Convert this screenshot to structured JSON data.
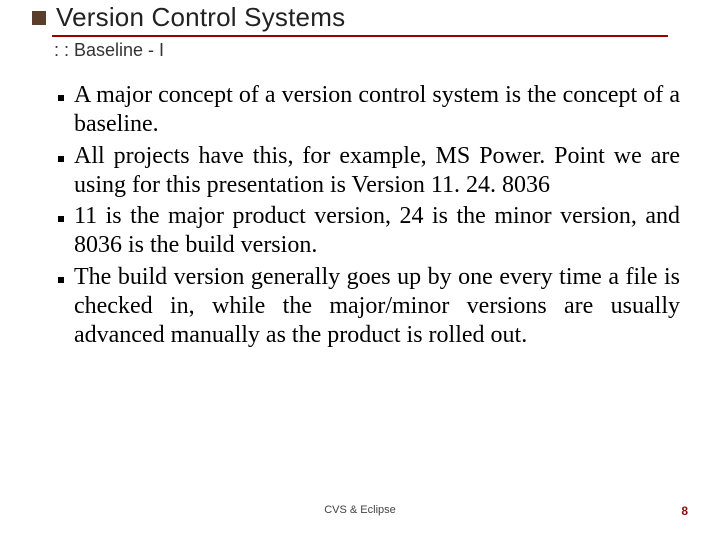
{
  "title": "Version Control Systems",
  "subtitle": ": : Baseline - I",
  "bullets": [
    "A major concept of a version control system is the concept of a baseline.",
    "All projects have this, for example, MS Power. Point we are using for this presentation is Version 11. 24. 8036",
    "11 is the major product version, 24 is the minor version, and 8036 is the build version.",
    "The build version generally goes up by one every time a file is checked in, while the major/minor versions are usually advanced manually as the product is rolled out."
  ],
  "footer": {
    "center": "CVS & Eclipse",
    "page": "8"
  }
}
